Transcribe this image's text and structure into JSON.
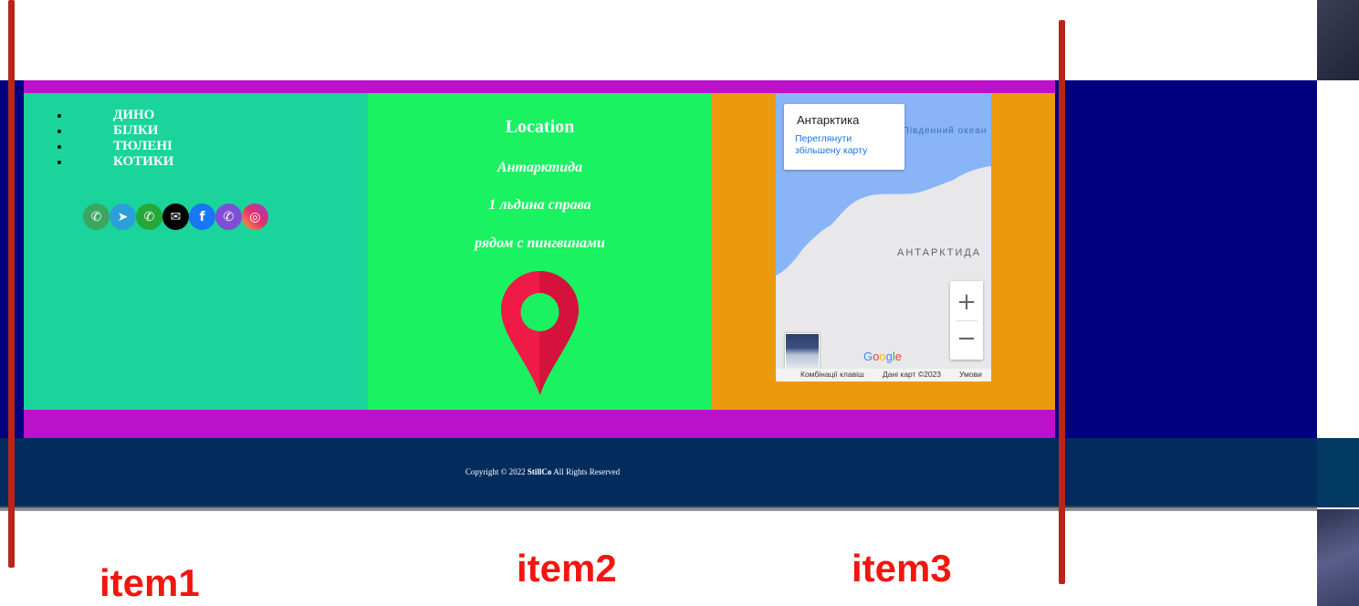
{
  "nav": {
    "items": [
      {
        "label": "ДИНО"
      },
      {
        "label": "БІЛКИ"
      },
      {
        "label": "ТЮЛЕНІ"
      },
      {
        "label": "КОТИКИ"
      }
    ]
  },
  "social": [
    {
      "name": "whatsapp-icon",
      "color": "#3aa660",
      "glyph": "✆"
    },
    {
      "name": "telegram-icon",
      "color": "#2a9fdc",
      "glyph": "➤"
    },
    {
      "name": "whatsapp-green-icon",
      "color": "#25a836",
      "glyph": "✆"
    },
    {
      "name": "email-icon",
      "color": "#000000",
      "glyph": "✉"
    },
    {
      "name": "facebook-icon",
      "color": "#1877f2",
      "glyph": "f"
    },
    {
      "name": "viber-icon",
      "color": "#7f4ed6",
      "glyph": "✆"
    },
    {
      "name": "instagram-icon",
      "color": "#e1306c",
      "glyph": "◎"
    }
  ],
  "location": {
    "title": "Location",
    "line1": "Антарктида",
    "line2": "1 льдина справа",
    "line3": "рядом с пингвинами"
  },
  "map": {
    "card_title": "Антарктика",
    "card_link": "Переглянути збільшену карту",
    "ocean_label": "Південний океан",
    "region_label": "АНТАРКТИДА",
    "zoom_in": "+",
    "zoom_out": "−",
    "google": "Google",
    "keyboard": "Комбінації клавіш",
    "map_data": "Дані карт ©2023",
    "terms": "Умови"
  },
  "footer": {
    "copyright_prefix": "Copyright © 2022",
    "brand": "StillCo",
    "copyright_suffix": "All Rights Reserved"
  },
  "labels": {
    "item1": "item1",
    "item2": "item2",
    "item3": "item3"
  },
  "colors": {
    "navy": "#00007f",
    "purple": "#bb11c8",
    "teal": "#1ad49b",
    "green": "#1af262",
    "orange": "#ec9a0d",
    "footer": "#022c5c",
    "marker": "#b8261a",
    "label": "#f2160f"
  }
}
